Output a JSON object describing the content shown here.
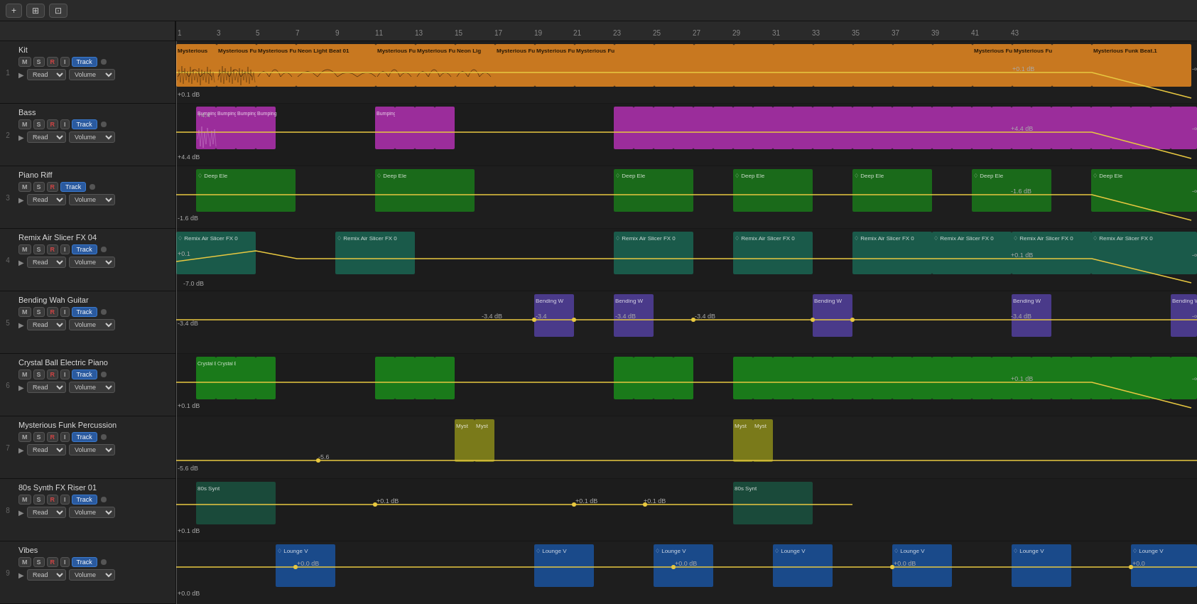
{
  "toolbar": {
    "add_btn": "+",
    "group_btn": "⊞",
    "expand_btn": "⊡"
  },
  "ruler": {
    "marks": [
      {
        "pos": 1,
        "label": "1"
      },
      {
        "pos": 3,
        "label": "3"
      },
      {
        "pos": 5,
        "label": "5"
      },
      {
        "pos": 7,
        "label": "7"
      },
      {
        "pos": 9,
        "label": "9"
      },
      {
        "pos": 11,
        "label": "11"
      },
      {
        "pos": 13,
        "label": "13"
      },
      {
        "pos": 15,
        "label": "15"
      },
      {
        "pos": 17,
        "label": "17"
      },
      {
        "pos": 19,
        "label": "19"
      },
      {
        "pos": 21,
        "label": "21"
      },
      {
        "pos": 23,
        "label": "23"
      },
      {
        "pos": 25,
        "label": "25"
      },
      {
        "pos": 27,
        "label": "27"
      },
      {
        "pos": 29,
        "label": "29"
      },
      {
        "pos": 31,
        "label": "31"
      },
      {
        "pos": 33,
        "label": "33"
      },
      {
        "pos": 35,
        "label": "35"
      },
      {
        "pos": 37,
        "label": "37"
      },
      {
        "pos": 39,
        "label": "39"
      },
      {
        "pos": 41,
        "label": "41"
      },
      {
        "pos": 43,
        "label": "43"
      }
    ]
  },
  "tracks": [
    {
      "number": "1",
      "name": "Kit",
      "color": "#c8760a",
      "db_label": "+0.1 dB",
      "track_btn_label": "Track",
      "read_label": "Read",
      "volume_label": "Volume"
    },
    {
      "number": "2",
      "name": "Bass",
      "color": "#9b2d9b",
      "db_label": "+4.4 dB",
      "track_btn_label": "Track",
      "read_label": "Read",
      "volume_label": "Volume"
    },
    {
      "number": "3",
      "name": "Piano Riff",
      "color": "#1a7a1a",
      "db_label": "-1.6 dB",
      "track_btn_label": "Track",
      "read_label": "Read",
      "volume_label": "Volume"
    },
    {
      "number": "4",
      "name": "Remix Air Slicer FX 04",
      "color": "#1a6a4a",
      "db_label": "+0.1",
      "track_btn_label": "Track",
      "read_label": "Read",
      "volume_label": "Volume"
    },
    {
      "number": "5",
      "name": "Bending Wah Guitar",
      "color": "#4a3a8a",
      "db_label": "-3.4 dB",
      "track_btn_label": "Track",
      "read_label": "Read",
      "volume_label": "Volume"
    },
    {
      "number": "6",
      "name": "Crystal Ball Electric Piano",
      "color": "#1a7a1a",
      "db_label": "+0.1 dB",
      "track_btn_label": "Track",
      "read_label": "Read",
      "volume_label": "Volume"
    },
    {
      "number": "7",
      "name": "Mysterious Funk Percussion",
      "color": "#8a8a1a",
      "db_label": "-5.6 dB",
      "track_btn_label": "Track",
      "read_label": "Read",
      "volume_label": "Volume"
    },
    {
      "number": "8",
      "name": "80s Synth FX Riser 01",
      "color": "#1a5a4a",
      "db_label": "+0.1 dB",
      "track_btn_label": "Track",
      "read_label": "Read",
      "volume_label": "Volume"
    },
    {
      "number": "9",
      "name": "Vibes",
      "color": "#1a5a9a",
      "db_label": "+0.0 dB",
      "track_btn_label": "Track",
      "read_label": "Read",
      "volume_label": "Volume"
    }
  ]
}
